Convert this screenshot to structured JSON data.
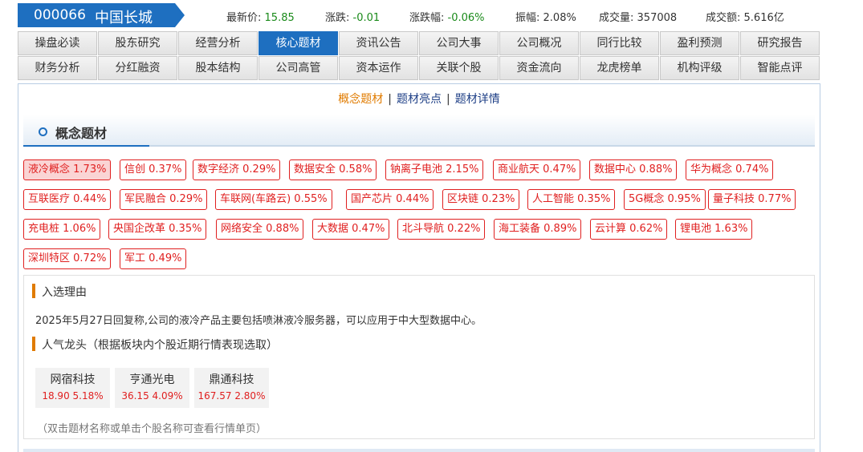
{
  "header": {
    "code": "000066",
    "name": "中国长城",
    "quotes": [
      {
        "label": "最新价:",
        "value": "15.85"
      },
      {
        "label": "涨跌:",
        "value": "-0.01"
      },
      {
        "label": "涨跌幅:",
        "value": "-0.06%"
      },
      {
        "label": "振幅:",
        "value": "2.08%"
      },
      {
        "label": "成交量:",
        "value": "357008"
      },
      {
        "label": "成交额:",
        "value": "5.616亿"
      }
    ]
  },
  "tabs": {
    "row1": [
      "操盘必读",
      "股东研究",
      "经营分析",
      "核心题材",
      "资讯公告",
      "公司大事",
      "公司概况",
      "同行比较",
      "盈利预测",
      "研究报告"
    ],
    "row2": [
      "财务分析",
      "分红融资",
      "股本结构",
      "公司高管",
      "资本运作",
      "关联个股",
      "资金流向",
      "龙虎榜单",
      "机构评级",
      "智能点评"
    ],
    "active": "核心题材"
  },
  "sublinks": [
    "概念题材",
    "题材亮点",
    "题材详情"
  ],
  "section_title": "概念题材",
  "concepts": [
    {
      "name": "液冷概念",
      "pct": "1.73%"
    },
    {
      "name": "信创",
      "pct": "0.37%"
    },
    {
      "name": "数字经济",
      "pct": "0.29%"
    },
    {
      "name": "数据安全",
      "pct": "0.58%"
    },
    {
      "name": "钠离子电池",
      "pct": "2.15%"
    },
    {
      "name": "商业航天",
      "pct": "0.47%"
    },
    {
      "name": "数据中心",
      "pct": "0.88%"
    },
    {
      "name": "华为概念",
      "pct": "0.74%"
    },
    {
      "name": "互联医疗",
      "pct": "0.44%"
    },
    {
      "name": "军民融合",
      "pct": "0.29%"
    },
    {
      "name": "车联网(车路云)",
      "pct": "0.55%"
    },
    {
      "name": "国产芯片",
      "pct": "0.44%"
    },
    {
      "name": "区块链",
      "pct": "0.23%"
    },
    {
      "name": "人工智能",
      "pct": "0.35%"
    },
    {
      "name": "5G概念",
      "pct": "0.95%"
    },
    {
      "name": "量子科技",
      "pct": "0.77%"
    },
    {
      "name": "充电桩",
      "pct": "1.06%"
    },
    {
      "name": "央国企改革",
      "pct": "0.35%"
    },
    {
      "name": "网络安全",
      "pct": "0.88%"
    },
    {
      "name": "大数据",
      "pct": "0.47%"
    },
    {
      "name": "北斗导航",
      "pct": "0.22%"
    },
    {
      "name": "海工装备",
      "pct": "0.89%"
    },
    {
      "name": "云计算",
      "pct": "0.62%"
    },
    {
      "name": "锂电池",
      "pct": "1.63%"
    },
    {
      "name": "深圳特区",
      "pct": "0.72%"
    },
    {
      "name": "军工",
      "pct": "0.49%"
    }
  ],
  "reason": {
    "heading": "入选理由",
    "text": "2025年5月27日回复称,公司的液冷产品主要包括喷淋液冷服务器，可以应用于中大型数据中心。"
  },
  "leaders": {
    "heading": "人气龙头（根据板块内个股近期行情表现选取）",
    "items": [
      {
        "name": "网宿科技",
        "price": "18.90",
        "pct": "5.18%"
      },
      {
        "name": "亨通光电",
        "price": "36.15",
        "pct": "4.09%"
      },
      {
        "name": "鼎通科技",
        "price": "167.57",
        "pct": "2.80%"
      }
    ]
  },
  "hint": "（双击题材名称或单击个股名称可查看行情单页）",
  "colors": {
    "accent_blue": "#1e6fc0",
    "up_red": "#e02020",
    "down_green": "#1a8a1a",
    "orange": "#e07b00"
  }
}
